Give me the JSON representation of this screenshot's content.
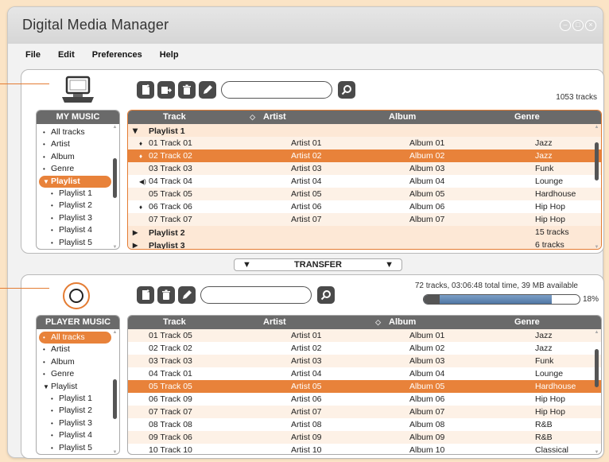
{
  "window": {
    "title": "Digital Media Manager",
    "controls": [
      "minimize",
      "maximize",
      "close"
    ]
  },
  "menu": [
    "File",
    "Edit",
    "Preferences",
    "Help"
  ],
  "library": {
    "track_count": "1053 tracks",
    "search_value": "",
    "nav": {
      "title": "MY MUSIC",
      "items": [
        {
          "label": "All tracks",
          "level": 0,
          "active": false
        },
        {
          "label": "Artist",
          "level": 0,
          "active": false
        },
        {
          "label": "Album",
          "level": 0,
          "active": false
        },
        {
          "label": "Genre",
          "level": 0,
          "active": false
        },
        {
          "label": "Playlist",
          "level": 0,
          "active": true,
          "expanded": true
        },
        {
          "label": "Playlist 1",
          "level": 1,
          "active": false
        },
        {
          "label": "Playlist 2",
          "level": 1,
          "active": false
        },
        {
          "label": "Playlist 3",
          "level": 1,
          "active": false
        },
        {
          "label": "Playlist 4",
          "level": 1,
          "active": false
        },
        {
          "label": "Playlist 5",
          "level": 1,
          "active": false
        }
      ]
    },
    "columns": [
      "Track",
      "Artist",
      "Album",
      "Genre"
    ],
    "rows": [
      {
        "type": "group",
        "expanded": true,
        "name": "Playlist 1",
        "genre": ""
      },
      {
        "marker": "♦",
        "num": "01",
        "track": "Track 01",
        "artist": "Artist 01",
        "album": "Album 01",
        "genre": "Jazz"
      },
      {
        "marker": "♦",
        "num": "02",
        "track": "Track 02",
        "artist": "Artist 02",
        "album": "Album 02",
        "genre": "Jazz",
        "selected": true
      },
      {
        "marker": "",
        "num": "03",
        "track": "Track 03",
        "artist": "Artist 03",
        "album": "Album 03",
        "genre": "Funk"
      },
      {
        "marker": "◀)",
        "num": "04",
        "track": "Track 04",
        "artist": "Artist 04",
        "album": "Album 04",
        "genre": "Lounge"
      },
      {
        "marker": "",
        "num": "05",
        "track": "Track 05",
        "artist": "Artist 05",
        "album": "Album 05",
        "genre": "Hardhouse"
      },
      {
        "marker": "♦",
        "num": "06",
        "track": "Track 06",
        "artist": "Artist 06",
        "album": "Album 06",
        "genre": "Hip Hop"
      },
      {
        "marker": "",
        "num": "07",
        "track": "Track 07",
        "artist": "Artist 07",
        "album": "Album 07",
        "genre": "Hip Hop"
      },
      {
        "type": "group",
        "expanded": false,
        "name": "Playlist 2",
        "genre": "15 tracks"
      },
      {
        "type": "group",
        "expanded": false,
        "name": "Playlist 3",
        "genre": "6 tracks"
      }
    ]
  },
  "transfer": {
    "label": "TRANSFER"
  },
  "player": {
    "status": "72 tracks, 03:06:48 total time, 39 MB available",
    "capacity_percent": "18%",
    "capacity_fraction": 0.82,
    "search_value": "",
    "nav": {
      "title": "PLAYER MUSIC",
      "items": [
        {
          "label": "All tracks",
          "level": 0,
          "active": true
        },
        {
          "label": "Artist",
          "level": 0,
          "active": false
        },
        {
          "label": "Album",
          "level": 0,
          "active": false
        },
        {
          "label": "Genre",
          "level": 0,
          "active": false
        },
        {
          "label": "Playlist",
          "level": 0,
          "active": false,
          "expanded": true
        },
        {
          "label": "Playlist 1",
          "level": 1,
          "active": false
        },
        {
          "label": "Playlist 2",
          "level": 1,
          "active": false
        },
        {
          "label": "Playlist 3",
          "level": 1,
          "active": false
        },
        {
          "label": "Playlist 4",
          "level": 1,
          "active": false
        },
        {
          "label": "Playlist 5",
          "level": 1,
          "active": false
        }
      ]
    },
    "columns": [
      "Track",
      "Artist",
      "Album",
      "Genre"
    ],
    "rows": [
      {
        "num": "01",
        "track": "Track 05",
        "artist": "Artist 01",
        "album": "Album 01",
        "genre": "Jazz"
      },
      {
        "num": "02",
        "track": "Track 02",
        "artist": "Artist 02",
        "album": "Album 02",
        "genre": "Jazz"
      },
      {
        "num": "03",
        "track": "Track 03",
        "artist": "Artist 03",
        "album": "Album 03",
        "genre": "Funk"
      },
      {
        "num": "04",
        "track": "Track 01",
        "artist": "Artist 04",
        "album": "Album 04",
        "genre": "Lounge"
      },
      {
        "num": "05",
        "track": "Track 05",
        "artist": "Artist 05",
        "album": "Album 05",
        "genre": "Hardhouse",
        "selected": true
      },
      {
        "num": "06",
        "track": "Track 09",
        "artist": "Artist 06",
        "album": "Album 06",
        "genre": "Hip Hop"
      },
      {
        "num": "07",
        "track": "Track 07",
        "artist": "Artist 07",
        "album": "Album 07",
        "genre": "Hip Hop"
      },
      {
        "num": "08",
        "track": "Track 08",
        "artist": "Artist 08",
        "album": "Album 08",
        "genre": "R&B"
      },
      {
        "num": "09",
        "track": "Track 06",
        "artist": "Artist 09",
        "album": "Album 09",
        "genre": "R&B"
      },
      {
        "num": "10",
        "track": "Track 10",
        "artist": "Artist 10",
        "album": "Album 10",
        "genre": "Classical"
      }
    ]
  },
  "colors": {
    "accent": "#e8823a",
    "background": "#fbe4c6",
    "header": "#6a6a6a"
  }
}
